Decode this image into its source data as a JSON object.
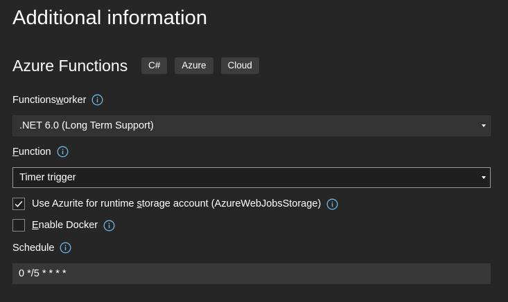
{
  "page": {
    "title": "Additional information"
  },
  "template": {
    "name": "Azure Functions",
    "tags": [
      "C#",
      "Azure",
      "Cloud"
    ]
  },
  "functions_worker": {
    "label_pre": "Functions ",
    "label_access": "w",
    "label_post": "orker",
    "value": ".NET 6.0 (Long Term Support)"
  },
  "function": {
    "label_access": "F",
    "label_post": "unction",
    "value": "Timer trigger"
  },
  "azurite": {
    "label_pre": "Use Azurite for runtime ",
    "label_access": "s",
    "label_post": "torage account (AzureWebJobsStorage)",
    "checked": true
  },
  "docker": {
    "label_access": "E",
    "label_post": "nable Docker",
    "checked": false
  },
  "schedule": {
    "label": "Schedule",
    "value": "0 */5 * * * *"
  },
  "colors": {
    "background": "#262626",
    "info_icon": "#6cb8e6",
    "tag_bg": "#3d3d3d"
  },
  "icons": {
    "info": "info-icon",
    "checkmark": "checkmark-icon",
    "dropdown": "chevron-down-icon"
  }
}
